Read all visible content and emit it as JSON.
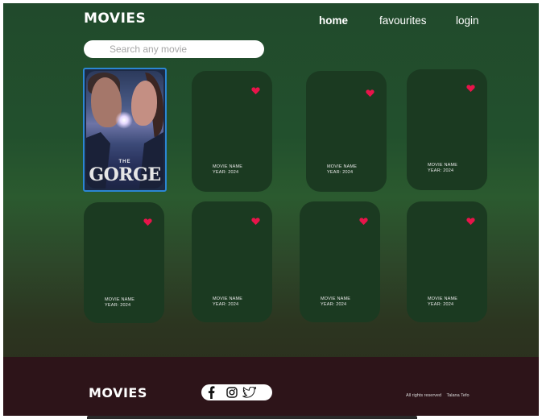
{
  "header": {
    "brand": "MOVIES",
    "nav": {
      "home": "home",
      "favourites": "favourites",
      "login": "login"
    }
  },
  "search": {
    "placeholder": "Search any movie",
    "value": ""
  },
  "poster": {
    "title_small": "THE",
    "title_large": "GORGE"
  },
  "movies": [
    {
      "name": "MOVIE NAME",
      "year": "YEAR: 2024"
    },
    {
      "name": "MOVIE NAME",
      "year": "YEAR: 2024"
    },
    {
      "name": "MOVIE NAME",
      "year": "YEAR: 2024"
    },
    {
      "name": "MOVIE NAME",
      "year": "YEAR: 2024"
    },
    {
      "name": "MOVIE NAME",
      "year": "YEAR: 2024"
    },
    {
      "name": "MOVIE NAME",
      "year": "YEAR: 2024"
    },
    {
      "name": "MOVIE NAME",
      "year": "YEAR: 2024"
    }
  ],
  "icons": {
    "favourite": "heart-icon",
    "facebook": "facebook-icon",
    "instagram": "instagram-icon",
    "twitter": "twitter-icon"
  },
  "colors": {
    "heart": "#e8144a",
    "selection": "#2b86d3",
    "footer": "#2d1419",
    "card": "#1b3a21"
  },
  "footer": {
    "brand": "MOVIES",
    "rights": "All rights reserved",
    "author": "Talana Tefo"
  }
}
